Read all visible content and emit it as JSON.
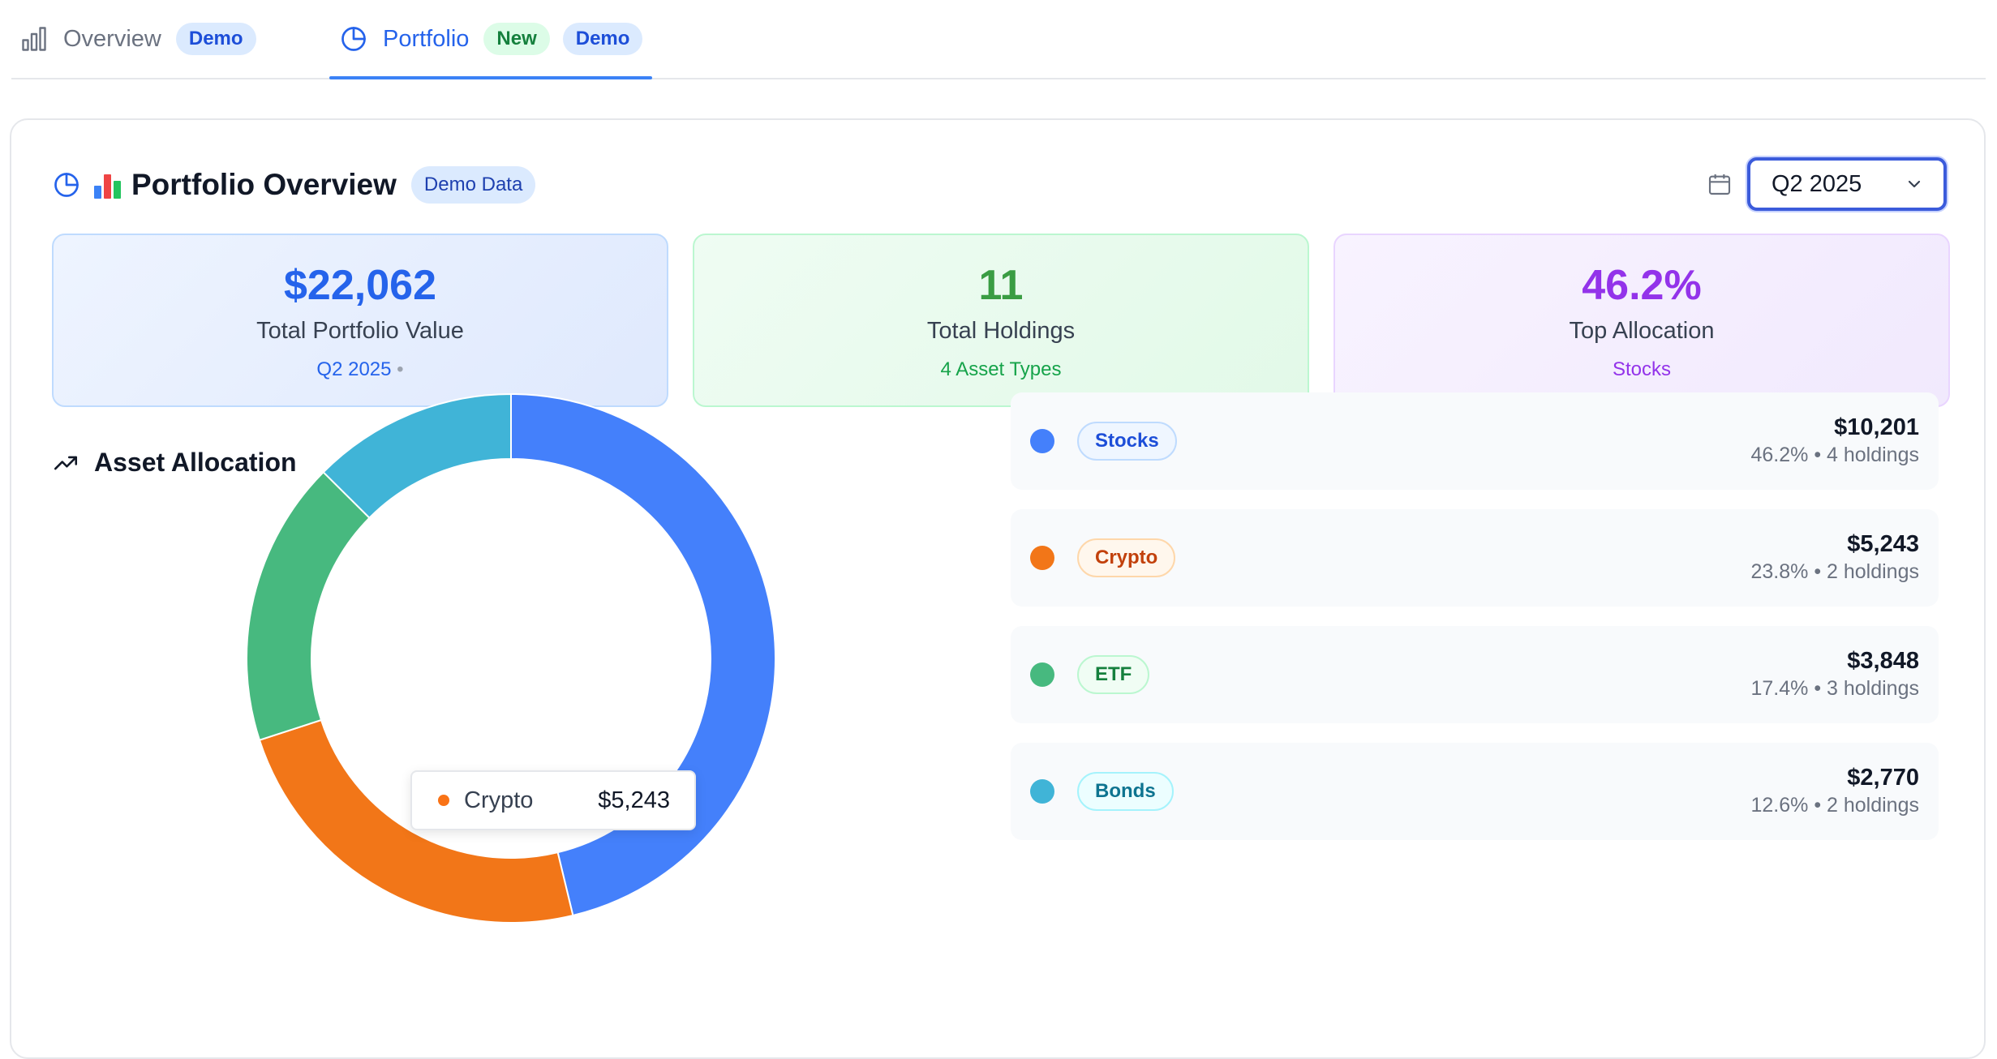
{
  "tabs": [
    {
      "label": "Overview",
      "badges": [
        "Demo"
      ]
    },
    {
      "label": "Portfolio",
      "badges": [
        "New",
        "Demo"
      ]
    }
  ],
  "header": {
    "emoji": "📊",
    "title": "Portfolio Overview",
    "badge": "Demo Data",
    "period": "Q2 2025"
  },
  "stats": [
    {
      "value": "$22,062",
      "label": "Total Portfolio Value",
      "sub": "Q2 2025",
      "sub_suffix": "•"
    },
    {
      "value": "11",
      "label": "Total Holdings",
      "sub": "4 Asset Types"
    },
    {
      "value": "46.2%",
      "label": "Top Allocation",
      "sub": "Stocks"
    }
  ],
  "allocation": {
    "title": "Asset Allocation",
    "tooltip": {
      "label": "Crypto",
      "value": "$5,243"
    }
  },
  "colors": {
    "stocks": "#4480fb",
    "crypto": "#f27618",
    "etf": "#47b97f",
    "bonds": "#40b4d7"
  },
  "chart_data": {
    "type": "pie",
    "donut": true,
    "categories": [
      "Stocks",
      "Crypto",
      "ETF",
      "Bonds"
    ],
    "values": [
      10201,
      5243,
      3848,
      2770
    ],
    "percent": [
      46.2,
      23.8,
      17.4,
      12.6
    ],
    "colors": [
      "#4480fb",
      "#f27618",
      "#47b97f",
      "#40b4d7"
    ]
  },
  "legend": [
    {
      "name": "Stocks",
      "value": "$10,201",
      "meta": "46.2% • 4 holdings",
      "color": "#4480fb",
      "pill_bg": "#eff6ff",
      "pill_border": "#bfdbfe",
      "pill_text": "#1d4ed8"
    },
    {
      "name": "Crypto",
      "value": "$5,243",
      "meta": "23.8% • 2 holdings",
      "color": "#f27618",
      "pill_bg": "#fff7ed",
      "pill_border": "#fed7aa",
      "pill_text": "#c2410c"
    },
    {
      "name": "ETF",
      "value": "$3,848",
      "meta": "17.4% • 3 holdings",
      "color": "#47b97f",
      "pill_bg": "#f0fdf4",
      "pill_border": "#bbf7d0",
      "pill_text": "#15803d"
    },
    {
      "name": "Bonds",
      "value": "$2,770",
      "meta": "12.6% • 2 holdings",
      "color": "#40b4d7",
      "pill_bg": "#ecfeff",
      "pill_border": "#a5f3fc",
      "pill_text": "#0e7490"
    }
  ]
}
